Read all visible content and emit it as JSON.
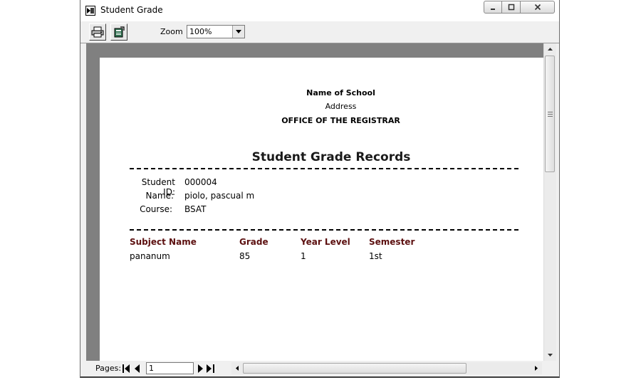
{
  "window": {
    "title": "Student Grade"
  },
  "toolbar": {
    "zoom_label": "Zoom",
    "zoom_value": "100%"
  },
  "report": {
    "school_name": "Name of School",
    "address": "Address",
    "office": "OFFICE OF THE REGISTRAR",
    "title": "Student Grade Records",
    "student_id_label": "Student ID:",
    "student_id": "000004",
    "name_label": "Name:",
    "name": "piolo, pascual m",
    "course_label": "Course:",
    "course": "BSAT",
    "columns": [
      "Subject Name",
      "Grade",
      "Year Level",
      "Semester"
    ],
    "rows": [
      [
        "pananum",
        "85",
        "1",
        "1st"
      ]
    ]
  },
  "status": {
    "pages_label": "Pages:",
    "page_value": "1"
  },
  "colors": {
    "column_header": "#5c1010",
    "viewport_bg": "#808080"
  }
}
